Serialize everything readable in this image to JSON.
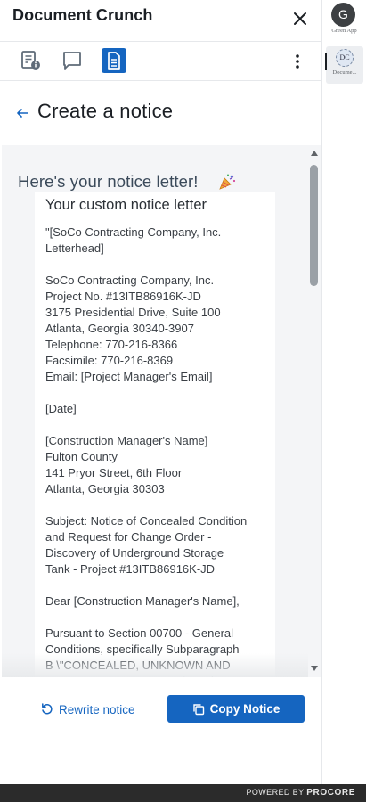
{
  "header": {
    "title": "Document Crunch"
  },
  "toolbar": {
    "tools": [
      {
        "icon": "document-info-icon"
      },
      {
        "icon": "chat-bubble-icon"
      },
      {
        "icon": "document-icon",
        "active": true
      }
    ]
  },
  "page": {
    "title": "Create a notice"
  },
  "result": {
    "heading": "Here's your notice letter!",
    "emoji": "party-popper-icon"
  },
  "letter": {
    "title": "Your custom notice letter",
    "body": "\"[SoCo Contracting Company, Inc.\nLetterhead]\n\nSoCo Contracting Company, Inc.\nProject No. #13ITB86916K-JD\n3175 Presidential Drive, Suite 100\nAtlanta, Georgia 30340-3907\nTelephone: 770-216-8366\nFacsimile: 770-216-8369\nEmail: [Project Manager's Email]\n\n[Date]\n\n[Construction Manager's Name]\nFulton County\n141 Pryor Street, 6th Floor\nAtlanta, Georgia 30303\n\nSubject: Notice of Concealed Condition\nand Request for Change Order -\nDiscovery of Underground Storage\nTank - Project #13ITB86916K-JD\n\nDear [Construction Manager's Name],\n\nPursuant to Section 00700 - General\nConditions, specifically Subparagraph\nB \\\"CONCEALED, UNKNOWN AND\nDIFFERING CONDITIONS\\\" and"
  },
  "actions": {
    "rewrite_label": "Rewrite notice",
    "copy_label": "Copy Notice"
  },
  "rail": {
    "apps": [
      {
        "avatar": "G",
        "label": "Green App"
      },
      {
        "logo": "DC",
        "label": "Docume..."
      }
    ]
  },
  "footer": {
    "powered_by": "POWERED BY",
    "brand": "PROCORE"
  },
  "colors": {
    "accent": "#1565c0",
    "footer_bg": "#2b2b2b",
    "content_bg": "#f4f5f7"
  }
}
